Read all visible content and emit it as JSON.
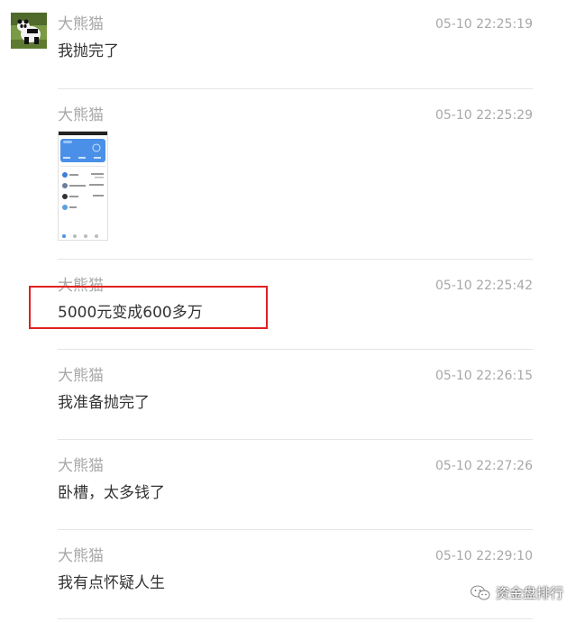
{
  "messages": [
    {
      "sender": "大熊猫",
      "time": "05-10 22:25:19",
      "text": "我抛完了"
    },
    {
      "sender": "大熊猫",
      "time": "05-10 22:25:29",
      "image_alt": "screenshot"
    },
    {
      "sender": "大熊猫",
      "time": "05-10 22:25:42",
      "text": "5000元变成600多万"
    },
    {
      "sender": "大熊猫",
      "time": "05-10 22:26:15",
      "text": "我准备抛完了"
    },
    {
      "sender": "大熊猫",
      "time": "05-10 22:27:26",
      "text": "卧槽，太多钱了"
    },
    {
      "sender": "大熊猫",
      "time": "05-10 22:29:10",
      "text": "我有点怀疑人生"
    }
  ],
  "thumbnail": {
    "balance": "6647086.96"
  },
  "watermark": {
    "text": "资金盘排行"
  },
  "colors": {
    "highlight_border": "#e02020",
    "meta_text": "#a8a8a8",
    "body_text": "#333333"
  }
}
